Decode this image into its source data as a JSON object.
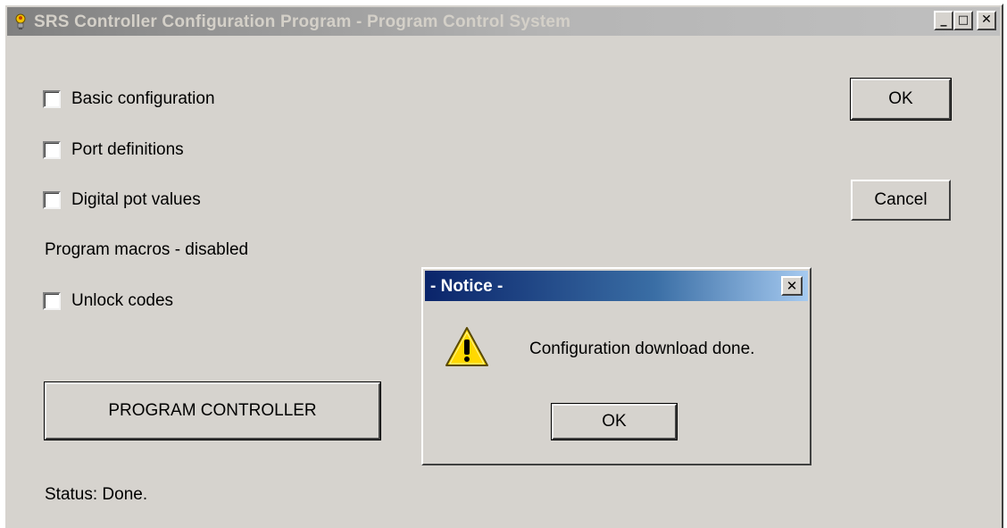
{
  "window": {
    "title": "SRS Controller Configuration Program - Program Control System",
    "minimize_glyph": "_",
    "maximize_glyph": "□",
    "close_glyph": "✕",
    "app_icon": "lightbulb-icon"
  },
  "options": {
    "basic_configuration": {
      "label": "Basic configuration",
      "checked": false
    },
    "port_definitions": {
      "label": "Port definitions",
      "checked": false
    },
    "digital_pot_values": {
      "label": "Digital pot values",
      "checked": false
    },
    "program_macros_text": "Program macros - disabled",
    "unlock_codes": {
      "label": "Unlock codes",
      "checked": false
    }
  },
  "buttons": {
    "ok": "OK",
    "cancel": "Cancel",
    "program_controller": "PROGRAM CONTROLLER"
  },
  "status": "Status: Done.",
  "notice_dialog": {
    "title": "- Notice -",
    "close_glyph": "✕",
    "icon": "warning-icon",
    "message": "Configuration download done.",
    "ok_button": "OK"
  },
  "colors": {
    "window_bg": "#d6d3ce",
    "inactive_title": "#808080",
    "active_title": "#0a246a",
    "warning_yellow": "#ffd800"
  }
}
